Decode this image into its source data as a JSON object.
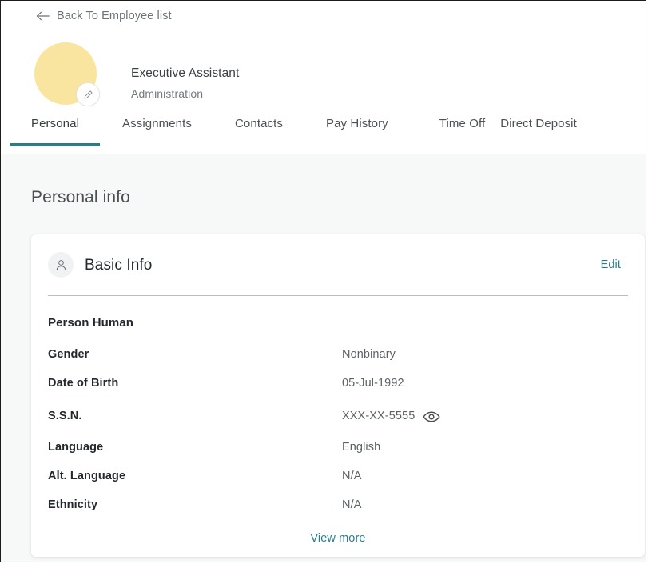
{
  "back_link": {
    "label": "Back To Employee list",
    "icon": "arrow-left-icon"
  },
  "employee": {
    "title": "Executive Assistant",
    "department": "Administration",
    "avatar_color": "#fae5a0",
    "edit_badge_icon": "pencil-icon"
  },
  "tabs": [
    {
      "label": "Personal",
      "active": true
    },
    {
      "label": "Assignments",
      "active": false
    },
    {
      "label": "Contacts",
      "active": false
    },
    {
      "label": "Pay History",
      "active": false
    },
    {
      "label": "Time Off",
      "active": false
    },
    {
      "label": "Direct Deposit",
      "active": false
    }
  ],
  "page": {
    "title": "Personal info",
    "accent_color": "#2a7b8c",
    "background_color": "#f7f8f8"
  },
  "card": {
    "icon": "person-icon",
    "title": "Basic Info",
    "edit_label": "Edit",
    "person_name": "Person Human",
    "fields": [
      {
        "label": "Gender",
        "value": "Nonbinary"
      },
      {
        "label": "Date of Birth",
        "value": "05-Jul-1992"
      },
      {
        "label": "S.S.N.",
        "value": "XXX-XX-5555",
        "reveal_icon": "eye-icon"
      },
      {
        "label": "Language",
        "value": "English"
      },
      {
        "label": "Alt. Language",
        "value": "N/A"
      },
      {
        "label": "Ethnicity",
        "value": "N/A"
      }
    ],
    "view_more_label": "View more"
  }
}
